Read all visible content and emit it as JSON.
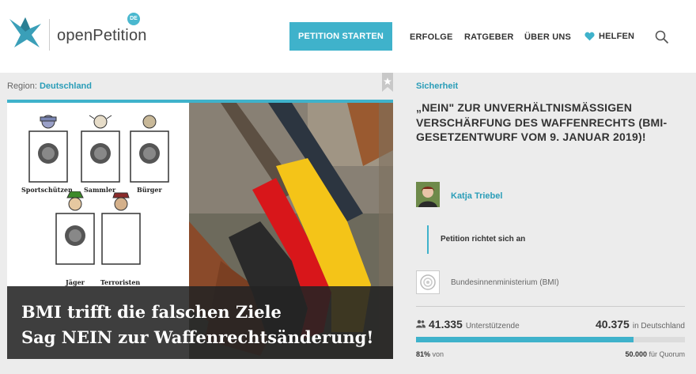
{
  "header": {
    "logo_text": "openPetition",
    "logo_badge": "DE",
    "start_button": "PETITION STARTEN",
    "nav": [
      "ERFOLGE",
      "RATGEBER",
      "ÜBER UNS",
      "HELFEN"
    ],
    "icons": [
      "logo-bird-icon",
      "heart-icon",
      "search-icon"
    ]
  },
  "petition": {
    "region_label": "Region:",
    "region": "Deutschland",
    "category": "Sicherheit",
    "title": "„NEIN\" ZUR UNVERHÄLTNISMÄSSIGEN VERSCHÄRFUNG DES WAFFENRECHTS (BMI-GESETZENTWURF VOM 9. JANUAR 2019)!",
    "author": "Katja Triebel",
    "target_label": "Petition richtet sich an",
    "recipient": "Bundesinnenministerium (BMI)"
  },
  "image": {
    "figure_labels": [
      "Sportschützen",
      "Sammler",
      "Bürger",
      "Jäger",
      "Terroristen"
    ],
    "caption_line1": "BMI trifft die falschen Ziele",
    "caption_line2": "Sag NEIN zur Waffenrechtsänderung!"
  },
  "stats": {
    "supporters": "41.335",
    "supporters_label": "Unterstützende",
    "germany": "40.375",
    "germany_label": "in Deutschland",
    "percent": "81%",
    "percent_suffix": "von",
    "progress_fraction": 0.81,
    "quorum": "50.000",
    "quorum_label": "für Quorum"
  },
  "colors": {
    "accent": "#3fb2cb",
    "link": "#2a9db8"
  }
}
